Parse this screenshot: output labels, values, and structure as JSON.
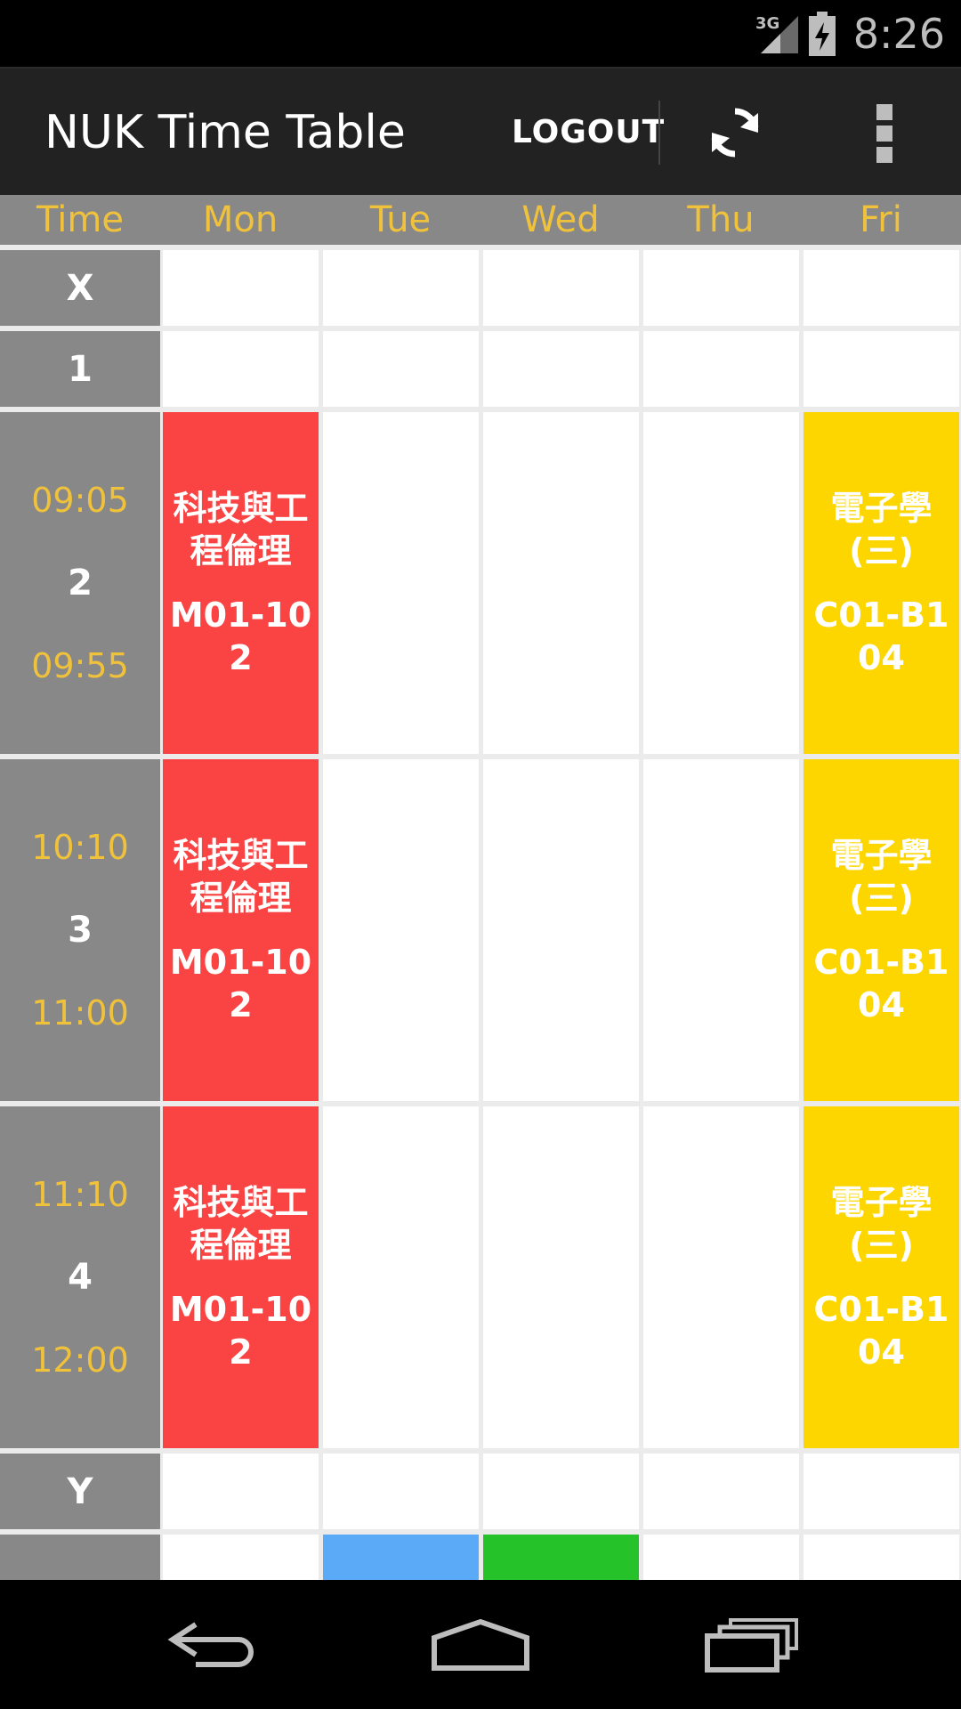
{
  "status": {
    "network": "3G",
    "time": "8:26"
  },
  "actionbar": {
    "title": "NUK Time Table",
    "logout_label": "LOGOUT",
    "refresh_icon": "refresh-icon",
    "menu_icon": "overflow-menu-icon"
  },
  "header": [
    "Time",
    "Mon",
    "Tue",
    "Wed",
    "Thu",
    "Fri"
  ],
  "rows": [
    {
      "period": "X",
      "start": "",
      "end": ""
    },
    {
      "period": "1",
      "start": "",
      "end": ""
    },
    {
      "period": "2",
      "start": "09:05",
      "end": "09:55"
    },
    {
      "period": "3",
      "start": "10:10",
      "end": "11:00"
    },
    {
      "period": "4",
      "start": "11:10",
      "end": "12:00"
    },
    {
      "period": "Y",
      "start": "",
      "end": ""
    },
    {
      "period": "",
      "start": "",
      "end": ""
    }
  ],
  "courses": {
    "ethics": {
      "name": "科技與工程倫理",
      "room": "M01-102",
      "color": "#fa4444"
    },
    "electronics": {
      "name": "電子學(三)",
      "room": "C01-B104",
      "color": "#fdd600"
    }
  },
  "colors": {
    "tue_partial": "#5aaaf8",
    "wed_partial": "#26c22a",
    "header_text": "#f0c23c",
    "slot_bg": "#888888"
  },
  "navbar": {
    "back_icon": "back-icon",
    "home_icon": "home-icon",
    "recents_icon": "recents-icon"
  }
}
